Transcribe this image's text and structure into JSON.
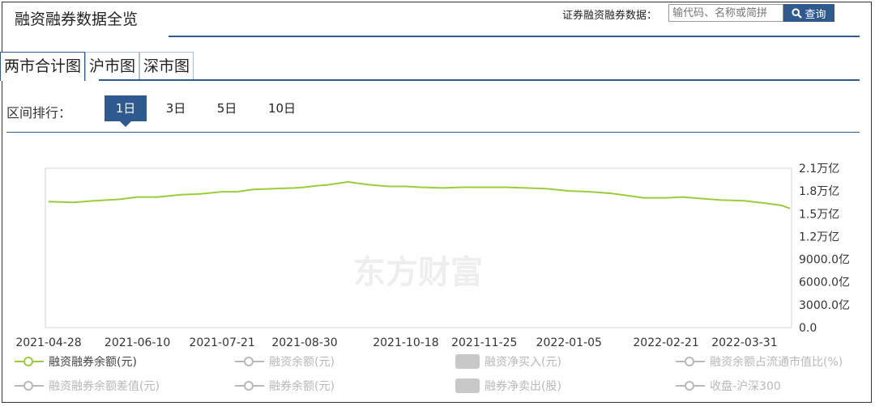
{
  "header": {
    "title": "融资融券数据全览",
    "search_label": "证券融资融券数据：",
    "search_placeholder": "输代码、名称或简拼",
    "search_button": "查询"
  },
  "tabs": [
    {
      "label": "两市合计图",
      "active": true
    },
    {
      "label": "沪市图",
      "active": false
    },
    {
      "label": "深市图",
      "active": false
    }
  ],
  "range": {
    "label": "区间排行：",
    "options": [
      {
        "label": "1日",
        "active": true
      },
      {
        "label": "3日",
        "active": false
      },
      {
        "label": "5日",
        "active": false
      },
      {
        "label": "10日",
        "active": false
      }
    ]
  },
  "watermark": "东方财富",
  "colors": {
    "accent": "#2f5a8f",
    "series": "#9bcc3c"
  },
  "chart_data": {
    "type": "line",
    "x_ticks": [
      "2021-04-28",
      "2021-06-10",
      "2021-07-21",
      "2021-08-30",
      "2021-10-18",
      "2021-11-25",
      "2022-01-05",
      "2022-02-21",
      "2022-03-31"
    ],
    "y_tick_labels": [
      "2.1万亿",
      "1.8万亿",
      "1.5万亿",
      "1.2万亿",
      "9000.0亿",
      "6000.0亿",
      "3000.0亿",
      "0.0"
    ],
    "ylim": [
      0,
      2.1
    ],
    "y_unit": "万亿",
    "series": [
      {
        "name": "融资融券余额(元)",
        "x": [
          "2021-04-28",
          "2021-05-10",
          "2021-05-20",
          "2021-06-01",
          "2021-06-10",
          "2021-06-20",
          "2021-07-01",
          "2021-07-10",
          "2021-07-21",
          "2021-07-28",
          "2021-08-05",
          "2021-08-15",
          "2021-08-25",
          "2021-08-30",
          "2021-09-05",
          "2021-09-10",
          "2021-09-15",
          "2021-09-20",
          "2021-09-25",
          "2021-10-01",
          "2021-10-10",
          "2021-10-18",
          "2021-10-25",
          "2021-11-05",
          "2021-11-15",
          "2021-11-25",
          "2021-12-05",
          "2021-12-15",
          "2021-12-25",
          "2022-01-05",
          "2022-01-15",
          "2022-01-25",
          "2022-02-05",
          "2022-02-10",
          "2022-02-21",
          "2022-03-01",
          "2022-03-10",
          "2022-03-20",
          "2022-03-31",
          "2022-04-10",
          "2022-04-18",
          "2022-04-22"
        ],
        "values": [
          1.66,
          1.65,
          1.67,
          1.69,
          1.72,
          1.72,
          1.75,
          1.76,
          1.79,
          1.79,
          1.82,
          1.83,
          1.84,
          1.85,
          1.87,
          1.88,
          1.9,
          1.92,
          1.9,
          1.88,
          1.86,
          1.86,
          1.85,
          1.84,
          1.85,
          1.85,
          1.85,
          1.84,
          1.83,
          1.8,
          1.79,
          1.77,
          1.73,
          1.71,
          1.71,
          1.72,
          1.7,
          1.68,
          1.67,
          1.64,
          1.61,
          1.57
        ]
      }
    ],
    "legend": [
      {
        "name": "融资融券余额(元)",
        "marker": "line",
        "on": true
      },
      {
        "name": "融资余额(元)",
        "marker": "line",
        "on": false
      },
      {
        "name": "融资净买入(元)",
        "marker": "rect",
        "on": false
      },
      {
        "name": "融资余额占流通市值比(%)",
        "marker": "line",
        "on": false
      },
      {
        "name": "融资融券余额差值(元)",
        "marker": "line",
        "on": false
      },
      {
        "name": "融券余额(元)",
        "marker": "line",
        "on": false
      },
      {
        "name": "融券净卖出(股)",
        "marker": "rect",
        "on": false
      },
      {
        "name": "收盘-沪深300",
        "marker": "line",
        "on": false
      }
    ],
    "grid": false,
    "legend_position": "bottom"
  }
}
